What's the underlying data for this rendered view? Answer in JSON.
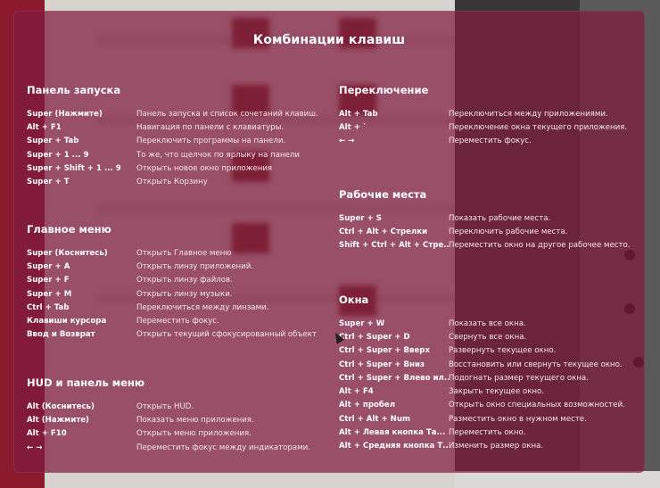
{
  "title": "Комбинации клавиш",
  "sections": {
    "launcher": {
      "heading": "Панель запуска",
      "rows": [
        {
          "key": "Super (Нажмите)",
          "desc": "Панель запуска и список сочетаний клавиш."
        },
        {
          "key": "Alt + F1",
          "desc": "Навигация по панели с клавиатуры."
        },
        {
          "key": "Super + Tab",
          "desc": "Переключить программы на панели."
        },
        {
          "key": "Super + 1 ... 9",
          "desc": "То же, что щелчок по ярлыку на панели"
        },
        {
          "key": "Super + Shift + 1 ... 9",
          "desc": "Открыть новое окно приложения"
        },
        {
          "key": "Super + T",
          "desc": "Открыть Корзину"
        }
      ]
    },
    "dash": {
      "heading": "Главное меню",
      "rows": [
        {
          "key": "Super (Коснитесь)",
          "desc": "Открыть Главное меню"
        },
        {
          "key": "Super + A",
          "desc": "Открыть линзу приложений."
        },
        {
          "key": "Super + F",
          "desc": "Открыть линзу файлов."
        },
        {
          "key": "Super + M",
          "desc": "Открыть линзу музыки."
        },
        {
          "key": "Ctrl + Tab",
          "desc": "Переключиться между линзами."
        },
        {
          "key": "Клавиши курсора",
          "desc": "Переместить фокус."
        },
        {
          "key": "Ввод и Возврат",
          "desc": "Открыть текущий сфокусированный объект"
        }
      ]
    },
    "hud": {
      "heading": "HUD и панель меню",
      "rows": [
        {
          "key": "Alt (Коснитесь)",
          "desc": "Открыть HUD."
        },
        {
          "key": "Alt (Нажмите)",
          "desc": "Показать меню приложения."
        },
        {
          "key": "Alt + F10",
          "desc": "Открыть меню приложения."
        },
        {
          "key": "← →",
          "desc": "Переместить фокус между индикаторами."
        }
      ]
    },
    "switching": {
      "heading": "Переключение",
      "rows": [
        {
          "key": "Alt + Tab",
          "desc": "Переключиться между приложениями."
        },
        {
          "key": "Alt + `",
          "desc": "Переключение окна текущего приложения."
        },
        {
          "key": "← →",
          "desc": "Переместить фокус."
        }
      ]
    },
    "workspaces": {
      "heading": "Рабочие места",
      "rows": [
        {
          "key": "Super + S",
          "desc": "Показать рабочие места."
        },
        {
          "key": "Ctrl + Alt + Стрелки",
          "desc": "Переключить рабочие места."
        },
        {
          "key": "Shift + Ctrl + Alt + Стре...",
          "desc": "Переместить окно на другое рабочее место."
        }
      ]
    },
    "windows": {
      "heading": "Окна",
      "rows": [
        {
          "key": "Super + W",
          "desc": "Показать все окна."
        },
        {
          "key": "Ctrl + Super + D",
          "desc": "Свернуть все окна."
        },
        {
          "key": "Ctrl + Super + Вверх",
          "desc": "Развернуть текущее окно."
        },
        {
          "key": "Ctrl + Super + Вниз",
          "desc": "Восстановить или свернуть текущее окно."
        },
        {
          "key": "Ctrl + Super + Влево ил...",
          "desc": "Подогнать размер текущего окна."
        },
        {
          "key": "Alt + F4",
          "desc": "Закрыть текущее окно."
        },
        {
          "key": "Alt + пробел",
          "desc": "Открыть окно специальных возможностей."
        },
        {
          "key": "Ctrl + Alt + Num",
          "desc": "Разместить окно в нужном месте."
        },
        {
          "key": "Alt + Левая кнопка Та...",
          "desc": "Переместить окно."
        },
        {
          "key": "Alt + Средняя кнопка Т...",
          "desc": "Изменить размер окна."
        }
      ]
    }
  }
}
